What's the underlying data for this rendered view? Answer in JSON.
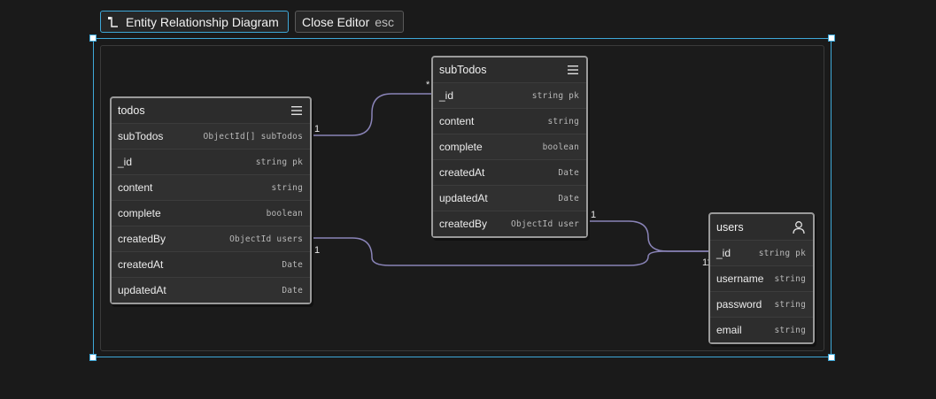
{
  "toolbar": {
    "diagram_label": "Entity Relationship Diagram",
    "close_label": "Close Editor",
    "close_shortcut": "esc"
  },
  "tables": {
    "todos": {
      "name": "todos",
      "fields": [
        {
          "name": "subTodos",
          "type": "ObjectId[] subTodos"
        },
        {
          "name": "_id",
          "type": "string pk"
        },
        {
          "name": "content",
          "type": "string"
        },
        {
          "name": "complete",
          "type": "boolean"
        },
        {
          "name": "createdBy",
          "type": "ObjectId users"
        },
        {
          "name": "createdAt",
          "type": "Date"
        },
        {
          "name": "updatedAt",
          "type": "Date"
        }
      ]
    },
    "subTodos": {
      "name": "subTodos",
      "fields": [
        {
          "name": "_id",
          "type": "string pk"
        },
        {
          "name": "content",
          "type": "string"
        },
        {
          "name": "complete",
          "type": "boolean"
        },
        {
          "name": "createdAt",
          "type": "Date"
        },
        {
          "name": "updatedAt",
          "type": "Date"
        },
        {
          "name": "createdBy",
          "type": "ObjectId user"
        }
      ]
    },
    "users": {
      "name": "users",
      "fields": [
        {
          "name": "_id",
          "type": "string pk"
        },
        {
          "name": "username",
          "type": "string"
        },
        {
          "name": "password",
          "type": "string"
        },
        {
          "name": "email",
          "type": "string"
        }
      ]
    }
  },
  "cardinality": {
    "todos_subtodos": "1",
    "subtodos_todos": "*",
    "todos_createdby": "1",
    "subtodos_createdby": "1",
    "users_id": "1 1"
  },
  "colors": {
    "accent": "#3ea8d8",
    "link": "#8a84b8"
  }
}
